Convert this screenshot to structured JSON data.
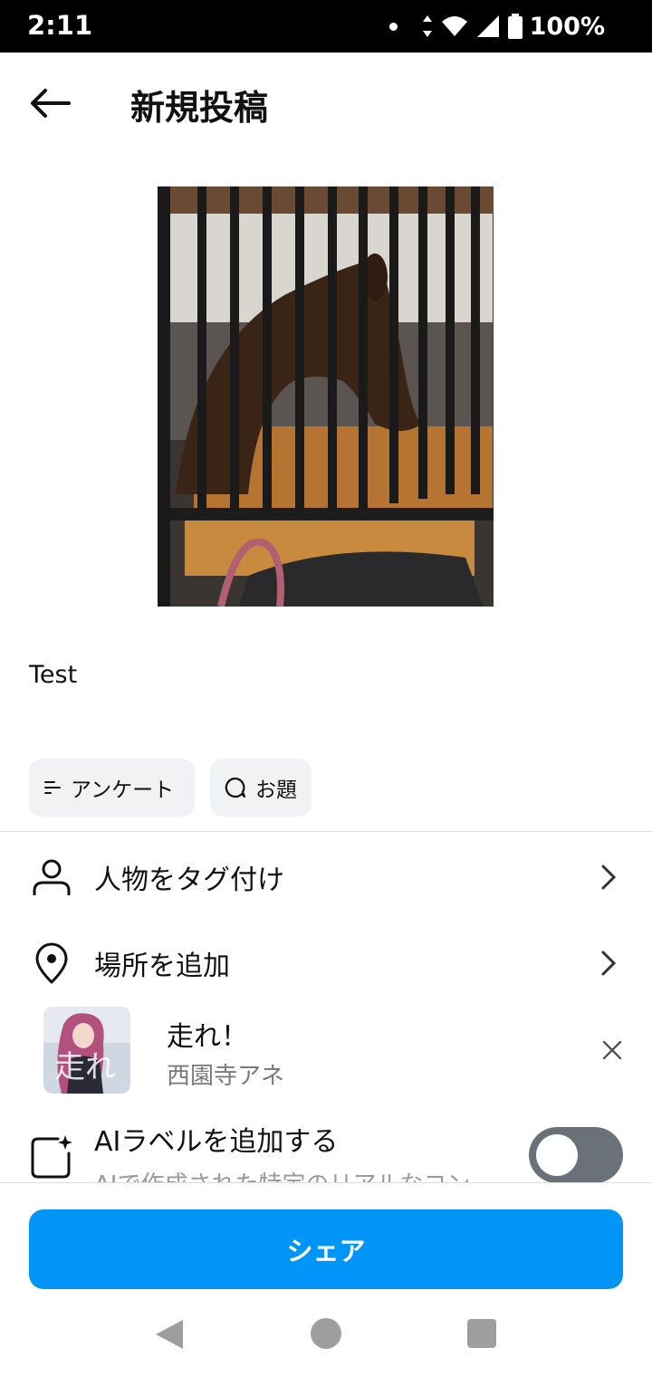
{
  "status_bar": {
    "time": "2:11",
    "battery": "100%",
    "icons": [
      "data-arrows-icon",
      "wifi-icon",
      "signal-icon",
      "battery-icon"
    ]
  },
  "header": {
    "title": "新規投稿",
    "back_icon": "arrow-left-icon"
  },
  "post": {
    "caption": "Test",
    "photo_subject": "horse-in-stable-photo"
  },
  "chips": {
    "poll_label": "アンケート",
    "topic_label": "お題"
  },
  "options": {
    "tag_people": "人物をタグ付け",
    "add_location": "場所を追加"
  },
  "music": {
    "title": "走れ！",
    "artist": "西園寺アネ"
  },
  "ai_label": {
    "title": "AIラベルを追加する",
    "description": "AIで作成された特定のリアルなコン",
    "toggle_on": false
  },
  "share_label": "シェア",
  "colors": {
    "accent": "#0095f6",
    "toggle_off": "#6b7178"
  }
}
